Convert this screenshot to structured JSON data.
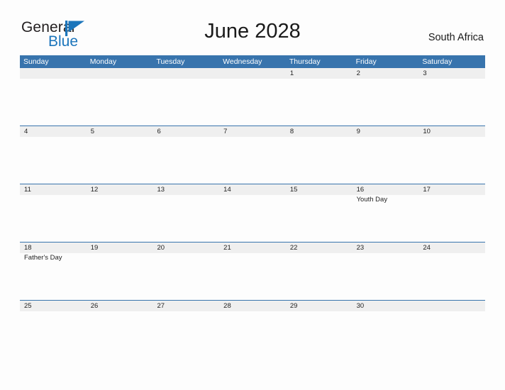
{
  "brand": {
    "name_part1": "General",
    "name_part2": "Blue",
    "flag_icon": "blue-flag-icon",
    "color_dark": "#231f20",
    "color_blue": "#1b75bb"
  },
  "header": {
    "title": "June 2028",
    "region": "South Africa"
  },
  "calendar": {
    "header_bg": "#3874ad",
    "date_strip_bg": "#efefef",
    "weekdays": [
      "Sunday",
      "Monday",
      "Tuesday",
      "Wednesday",
      "Thursday",
      "Friday",
      "Saturday"
    ],
    "weeks": [
      {
        "days": [
          {
            "date": "",
            "event": ""
          },
          {
            "date": "",
            "event": ""
          },
          {
            "date": "",
            "event": ""
          },
          {
            "date": "",
            "event": ""
          },
          {
            "date": "1",
            "event": ""
          },
          {
            "date": "2",
            "event": ""
          },
          {
            "date": "3",
            "event": ""
          }
        ]
      },
      {
        "days": [
          {
            "date": "4",
            "event": ""
          },
          {
            "date": "5",
            "event": ""
          },
          {
            "date": "6",
            "event": ""
          },
          {
            "date": "7",
            "event": ""
          },
          {
            "date": "8",
            "event": ""
          },
          {
            "date": "9",
            "event": ""
          },
          {
            "date": "10",
            "event": ""
          }
        ]
      },
      {
        "days": [
          {
            "date": "11",
            "event": ""
          },
          {
            "date": "12",
            "event": ""
          },
          {
            "date": "13",
            "event": ""
          },
          {
            "date": "14",
            "event": ""
          },
          {
            "date": "15",
            "event": ""
          },
          {
            "date": "16",
            "event": "Youth Day"
          },
          {
            "date": "17",
            "event": ""
          }
        ]
      },
      {
        "days": [
          {
            "date": "18",
            "event": "Father's Day"
          },
          {
            "date": "19",
            "event": ""
          },
          {
            "date": "20",
            "event": ""
          },
          {
            "date": "21",
            "event": ""
          },
          {
            "date": "22",
            "event": ""
          },
          {
            "date": "23",
            "event": ""
          },
          {
            "date": "24",
            "event": ""
          }
        ]
      },
      {
        "days": [
          {
            "date": "25",
            "event": ""
          },
          {
            "date": "26",
            "event": ""
          },
          {
            "date": "27",
            "event": ""
          },
          {
            "date": "28",
            "event": ""
          },
          {
            "date": "29",
            "event": ""
          },
          {
            "date": "30",
            "event": ""
          },
          {
            "date": "",
            "event": ""
          }
        ]
      }
    ]
  }
}
